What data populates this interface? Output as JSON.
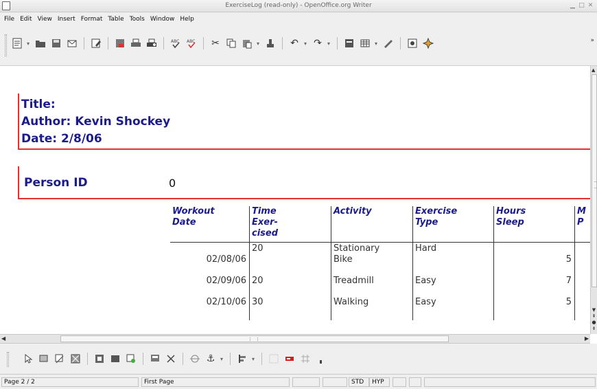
{
  "window": {
    "title": "ExerciseLog (read-only) - OpenOffice.org Writer"
  },
  "menubar": {
    "items": [
      "File",
      "Edit",
      "View",
      "Insert",
      "Format",
      "Table",
      "Tools",
      "Window",
      "Help"
    ]
  },
  "toolbar": {
    "icons": [
      "edit-file-icon",
      "open-folder-icon",
      "save-icon",
      "email-icon",
      "edit-doc-icon",
      "export-pdf-icon",
      "print-icon",
      "print-preview-icon",
      "spellcheck-icon",
      "autospellcheck-icon",
      "cut-icon",
      "copy-icon",
      "paste-icon",
      "clone-formatting-icon",
      "undo-icon",
      "redo-icon",
      "navigator-icon",
      "table-icon",
      "draw-functions-icon",
      "gallery-icon",
      "data-sources-icon"
    ]
  },
  "document": {
    "header": {
      "title_line": "Title:",
      "author_line": "Author: Kevin Shockey",
      "date_line": "Date:  2/8/06"
    },
    "person": {
      "label": "Person ID",
      "value": "0"
    },
    "table": {
      "columns": [
        "Workout\nDate",
        "Time Exer-\ncised",
        "Activity",
        "Exercise\nType",
        "Hours Sleep",
        "M\nP"
      ],
      "rows": [
        {
          "date": "02/08/06",
          "time": "20",
          "activity": "Stationary\nBike",
          "type": "Hard",
          "sleep": "5"
        },
        {
          "date": "02/09/06",
          "time": "20",
          "activity": "Treadmill",
          "type": "Easy",
          "sleep": "7"
        },
        {
          "date": "02/10/06",
          "time": "30",
          "activity": "Walking",
          "type": "Easy",
          "sleep": "5"
        }
      ]
    }
  },
  "statusbar": {
    "page": "Page 2 / 2",
    "page_style": "First Page",
    "std": "STD",
    "hyp": "HYP"
  },
  "colors": {
    "heading_blue": "#1b1b8a",
    "border_red": "#e03030"
  }
}
